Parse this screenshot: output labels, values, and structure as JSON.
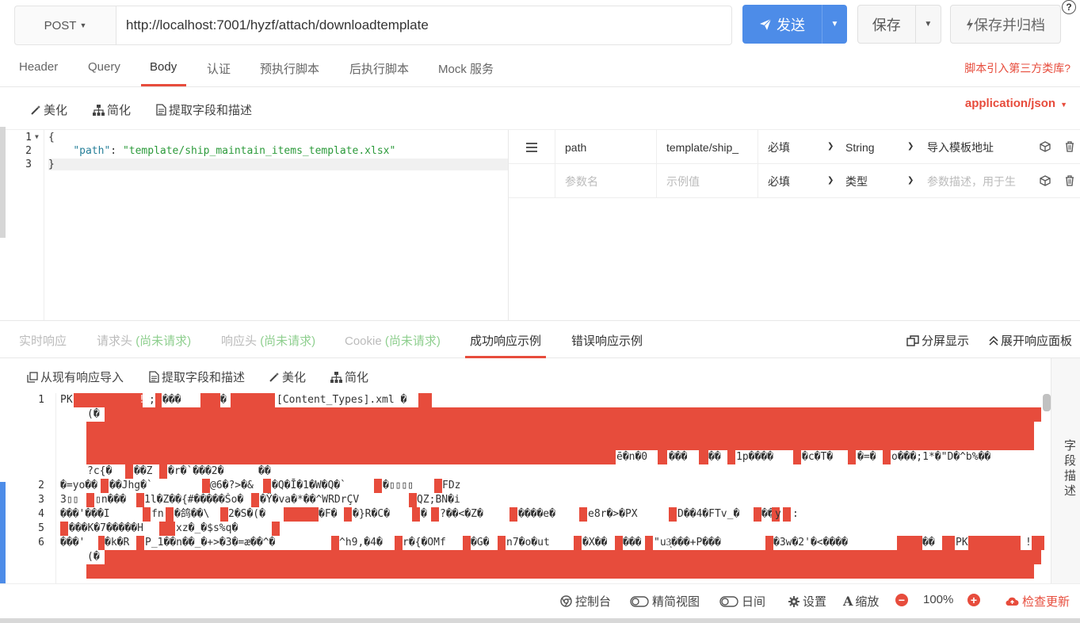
{
  "request": {
    "method": "POST",
    "url": "http://localhost:7001/hyzf/attach/downloadtemplate",
    "send_label": "发送",
    "save_label": "保存",
    "archive_label": "保存并归档",
    "help": "?"
  },
  "tabs": {
    "items": [
      "Header",
      "Query",
      "Body",
      "认证",
      "预执行脚本",
      "后执行脚本",
      "Mock 服务"
    ],
    "active": "Body",
    "right_link": "脚本引入第三方类库?"
  },
  "body_toolbar": {
    "beautify": "美化",
    "simplify": "简化",
    "extract": "提取字段和描述",
    "content_type": "application/json"
  },
  "editor": {
    "line_numbers": [
      "1",
      "2",
      "3"
    ],
    "line1": "{",
    "line2_key": "\"path\"",
    "line2_colon": ": ",
    "line2_value": "\"template/ship_maintain_items_template.xlsx\"",
    "line3": "}"
  },
  "params": {
    "row1": {
      "name": "path",
      "example": "template/ship_",
      "required": "必填",
      "type": "String",
      "desc": "导入模板地址"
    },
    "row2": {
      "name_placeholder": "参数名",
      "example_placeholder": "示例值",
      "required": "必填",
      "type_placeholder": "类型",
      "desc_placeholder": "参数描述，用于生"
    }
  },
  "response_tabs": {
    "realtime": "实时响应",
    "req_header": "请求头",
    "resp_header": "响应头",
    "cookie": "Cookie",
    "not_requested": "(尚未请求)",
    "success_example": "成功响应示例",
    "error_example": "错误响应示例",
    "split_view": "分屏显示",
    "expand_panel": "展开响应面板"
  },
  "response_toolbar": {
    "import": "从现有响应导入",
    "extract": "提取字段和描述",
    "beautify": "美化",
    "simplify": "简化",
    "side_label": "字段描述"
  },
  "response_body": {
    "line_numbers": [
      "1",
      "",
      "",
      "",
      "",
      "2",
      "3",
      "4",
      "5",
      "6",
      ""
    ],
    "l1_a": "PK",
    "l1_b": "!",
    "l1_c": ";",
    "l1_d": "���",
    "l1_e": "�",
    "l1_f": "[Content_Types].xml �",
    "l1w2_a": "(�",
    "l1w5_a": "ē�n�0",
    "l1w5_b": "���",
    "l1w5_c": "��",
    "l1w5_d": "1p����",
    "l1w5_e": "�c�T�",
    "l1w5_f": "�=�",
    "l1w5_g": "o���;1*�\"D�^b%��",
    "l1w6": "?c{�",
    "l1w6_b": "��Z",
    "l1w6_c": "�r�`���2�",
    "l1w6_d": "��",
    "l2": "�=yo��",
    "l2_b": "��Jhg�`",
    "l2_c": "@6�?>�&",
    "l2_d": "�Q�Ī�1�W�Q�`",
    "l2_e": "�▯▯▯▯",
    "l2_f": "FDz",
    "l3": "3▯▯",
    "l3_b": "▯n���",
    "l3_c": "1l�Z��{#�����Šo�",
    "l3_d": "�Ÿ�va�*��^WRDrÇV",
    "l3_e": "QZ;BN�i",
    "l4": "���'���I",
    "l4_b": "fn",
    "l4_c": "�鸽��\\",
    "l4_d": "2�S�(�",
    "l4_e": "�F�",
    "l4_f": "�}R�C�",
    "l4_g": "�",
    "l4_h": "?��<�Z�",
    "l4_i": "����e�",
    "l4_j": "e8r�>�PX",
    "l4_k": "D��4�FTv_�",
    "l4_l": "��",
    "l4_m": "y",
    "l4_n": ":",
    "l5": "���K�7�����H",
    "l5_b": "xz�_�$s%q�",
    "l6": "���'",
    "l6_b": "�k�R",
    "l6_c": "P_1��n��_�+>�3�=æ��^�",
    "l6_d": "^h9,�4�",
    "l6_e": "r�{�OMf",
    "l6_f": "�G�",
    "l6_g": "n7�o�ut",
    "l6_h": "�X��",
    "l6_i": "���",
    "l6_j": "\"u3ͅ���+P���",
    "l6_k": "�3w�2'�<����",
    "l6_l": "��",
    "l6_m": "PK",
    "l6_n": "!",
    "l6w2": "(�"
  },
  "footer": {
    "console": "控制台",
    "compact": "精简视图",
    "day": "日间",
    "settings": "设置",
    "zoom": "缩放",
    "zoom_level": "100%",
    "update": "检查更新"
  },
  "colors": {
    "accent": "#e74c3c",
    "primary": "#4d8ce8"
  }
}
